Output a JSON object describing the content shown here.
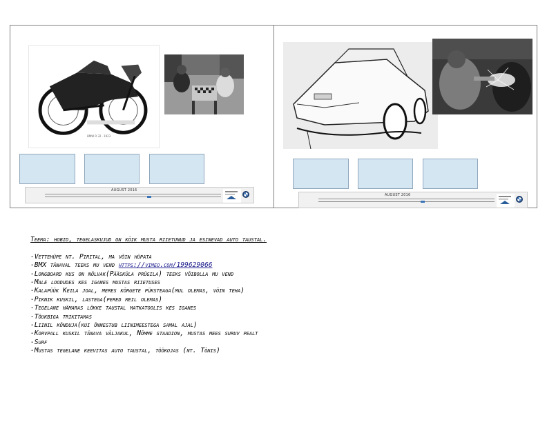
{
  "left_page": {
    "photos": [
      {
        "icon": "motorcycle-sketch-image"
      },
      {
        "icon": "chess-players-photo"
      }
    ],
    "placeholders": 3,
    "calendar": {
      "month": "AUGUST 2016"
    }
  },
  "right_page": {
    "photos": [
      {
        "icon": "car-sketch-image"
      },
      {
        "icon": "welder-photo"
      }
    ],
    "placeholders": 3,
    "calendar": {
      "month": "AUGUST 2016"
    }
  },
  "text": {
    "theme": "Teema: hobid, tegelaskujud on kõik musta riietunud ja esinevad auto taustal.",
    "items": [
      "-Vettehüpe nt. Pirital, ma võin hüpata",
      "-BMX tänaval teeks mu vend ",
      "-Longboard kus on nõlvak(Pääsküla prügila) teeks võibolla mu vend",
      "-Male loodudes kes iganes mustas riietuses",
      "-Kalapüük Keila joal, meres kõrgete püksteaga(mul olemas, võin teha)",
      "-Piknik kuskil, lastega(pered meil olemas)",
      "-Tegelane hämaras lõkke taustal matkatoolis kes iganes",
      "-Tõukbiga trikitamas",
      "-Liinil kõnduja(kui õnnestub liinimeestega samal ajal)",
      "-Korvpall kuskil tänava väljakul, Nõmme staadion, mustas mees suruv pealt",
      "-Surf",
      "-Mustas tegelane keevitas auto taustal, töökojas (nt. Tõnis)"
    ],
    "bmx_link": "https://vimeo.com/199629066"
  }
}
